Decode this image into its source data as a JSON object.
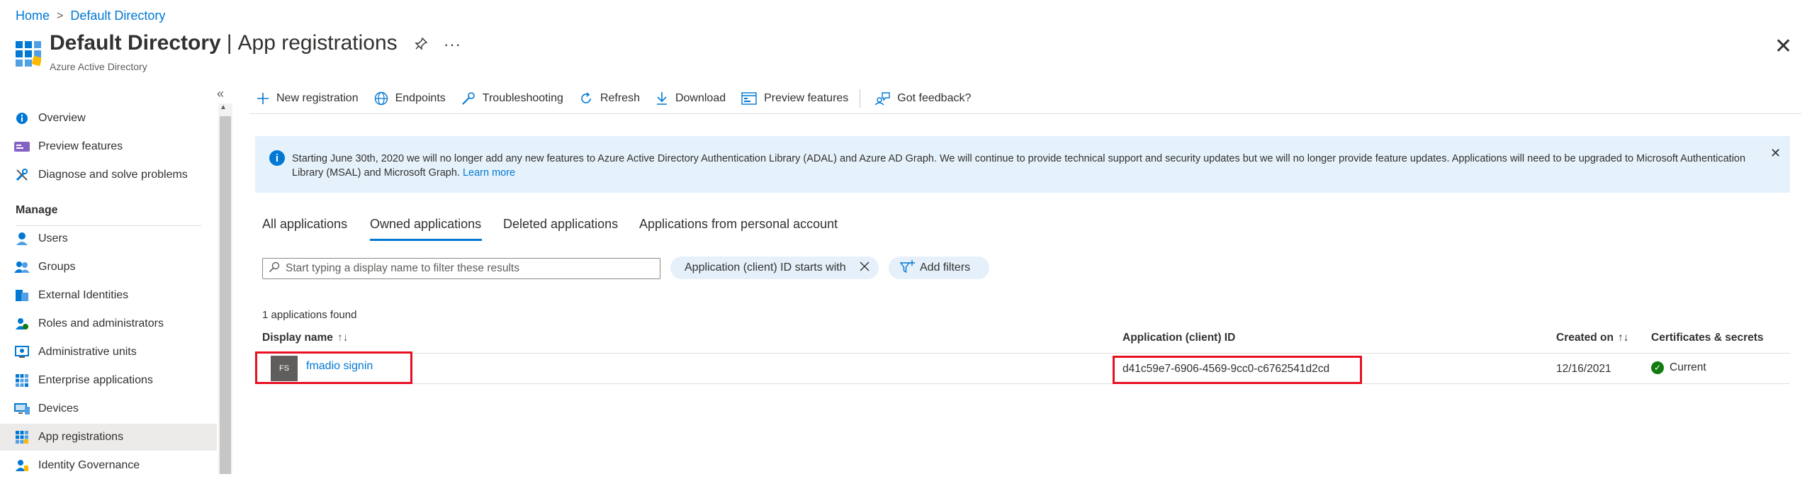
{
  "breadcrumb": {
    "home": "Home",
    "sep": ">",
    "current": "Default Directory"
  },
  "header": {
    "title_strong": "Default Directory",
    "title_sep": "|",
    "title_rest": "App registrations",
    "subtitle": "Azure Active Directory",
    "more": "···",
    "close": "✕"
  },
  "sidebar": {
    "collapse": "«",
    "items": [
      {
        "label": "Overview",
        "icon": "info-icon"
      },
      {
        "label": "Preview features",
        "icon": "preview-icon"
      },
      {
        "label": "Diagnose and solve problems",
        "icon": "wrench-icon"
      }
    ],
    "manage_heading": "Manage",
    "manage_items": [
      {
        "label": "Users",
        "icon": "user-icon"
      },
      {
        "label": "Groups",
        "icon": "groups-icon"
      },
      {
        "label": "External Identities",
        "icon": "external-identities-icon"
      },
      {
        "label": "Roles and administrators",
        "icon": "roles-icon"
      },
      {
        "label": "Administrative units",
        "icon": "admin-units-icon"
      },
      {
        "label": "Enterprise applications",
        "icon": "enterprise-apps-icon"
      },
      {
        "label": "Devices",
        "icon": "devices-icon"
      },
      {
        "label": "App registrations",
        "icon": "app-registrations-icon",
        "active": true
      },
      {
        "label": "Identity Governance",
        "icon": "identity-governance-icon"
      }
    ]
  },
  "toolbar": {
    "new_registration": "New registration",
    "endpoints": "Endpoints",
    "troubleshooting": "Troubleshooting",
    "refresh": "Refresh",
    "download": "Download",
    "preview_features": "Preview features",
    "feedback": "Got feedback?"
  },
  "banner": {
    "text": "Starting June 30th, 2020 we will no longer add any new features to Azure Active Directory Authentication Library (ADAL) and Azure AD Graph. We will continue to provide technical support and security updates but we will no longer provide feature updates. Applications will need to be upgraded to Microsoft Authentication Library (MSAL) and Microsoft Graph.",
    "link": "Learn more",
    "close": "✕"
  },
  "tabs": {
    "all": "All applications",
    "owned": "Owned applications",
    "deleted": "Deleted applications",
    "personal": "Applications from personal account",
    "active": "owned"
  },
  "filters": {
    "search_placeholder": "Start typing a display name to filter these results",
    "pill_label": "Application (client) ID starts with",
    "add_filters": "Add filters"
  },
  "results": {
    "count_text": "1 applications found",
    "columns": {
      "display_name": "Display name",
      "client_id": "Application (client) ID",
      "created_on": "Created on",
      "certs": "Certificates & secrets"
    },
    "rows": [
      {
        "avatar": "FS",
        "name": "fmadio signin",
        "client_id": "d41c59e7-6906-4569-9cc0-c6762541d2cd",
        "created_on": "12/16/2021",
        "certs": "Current"
      }
    ]
  },
  "colors": {
    "accent": "#0078d4",
    "banner_bg": "#e6f2fb",
    "highlight": "#e81123",
    "success": "#107c10"
  }
}
